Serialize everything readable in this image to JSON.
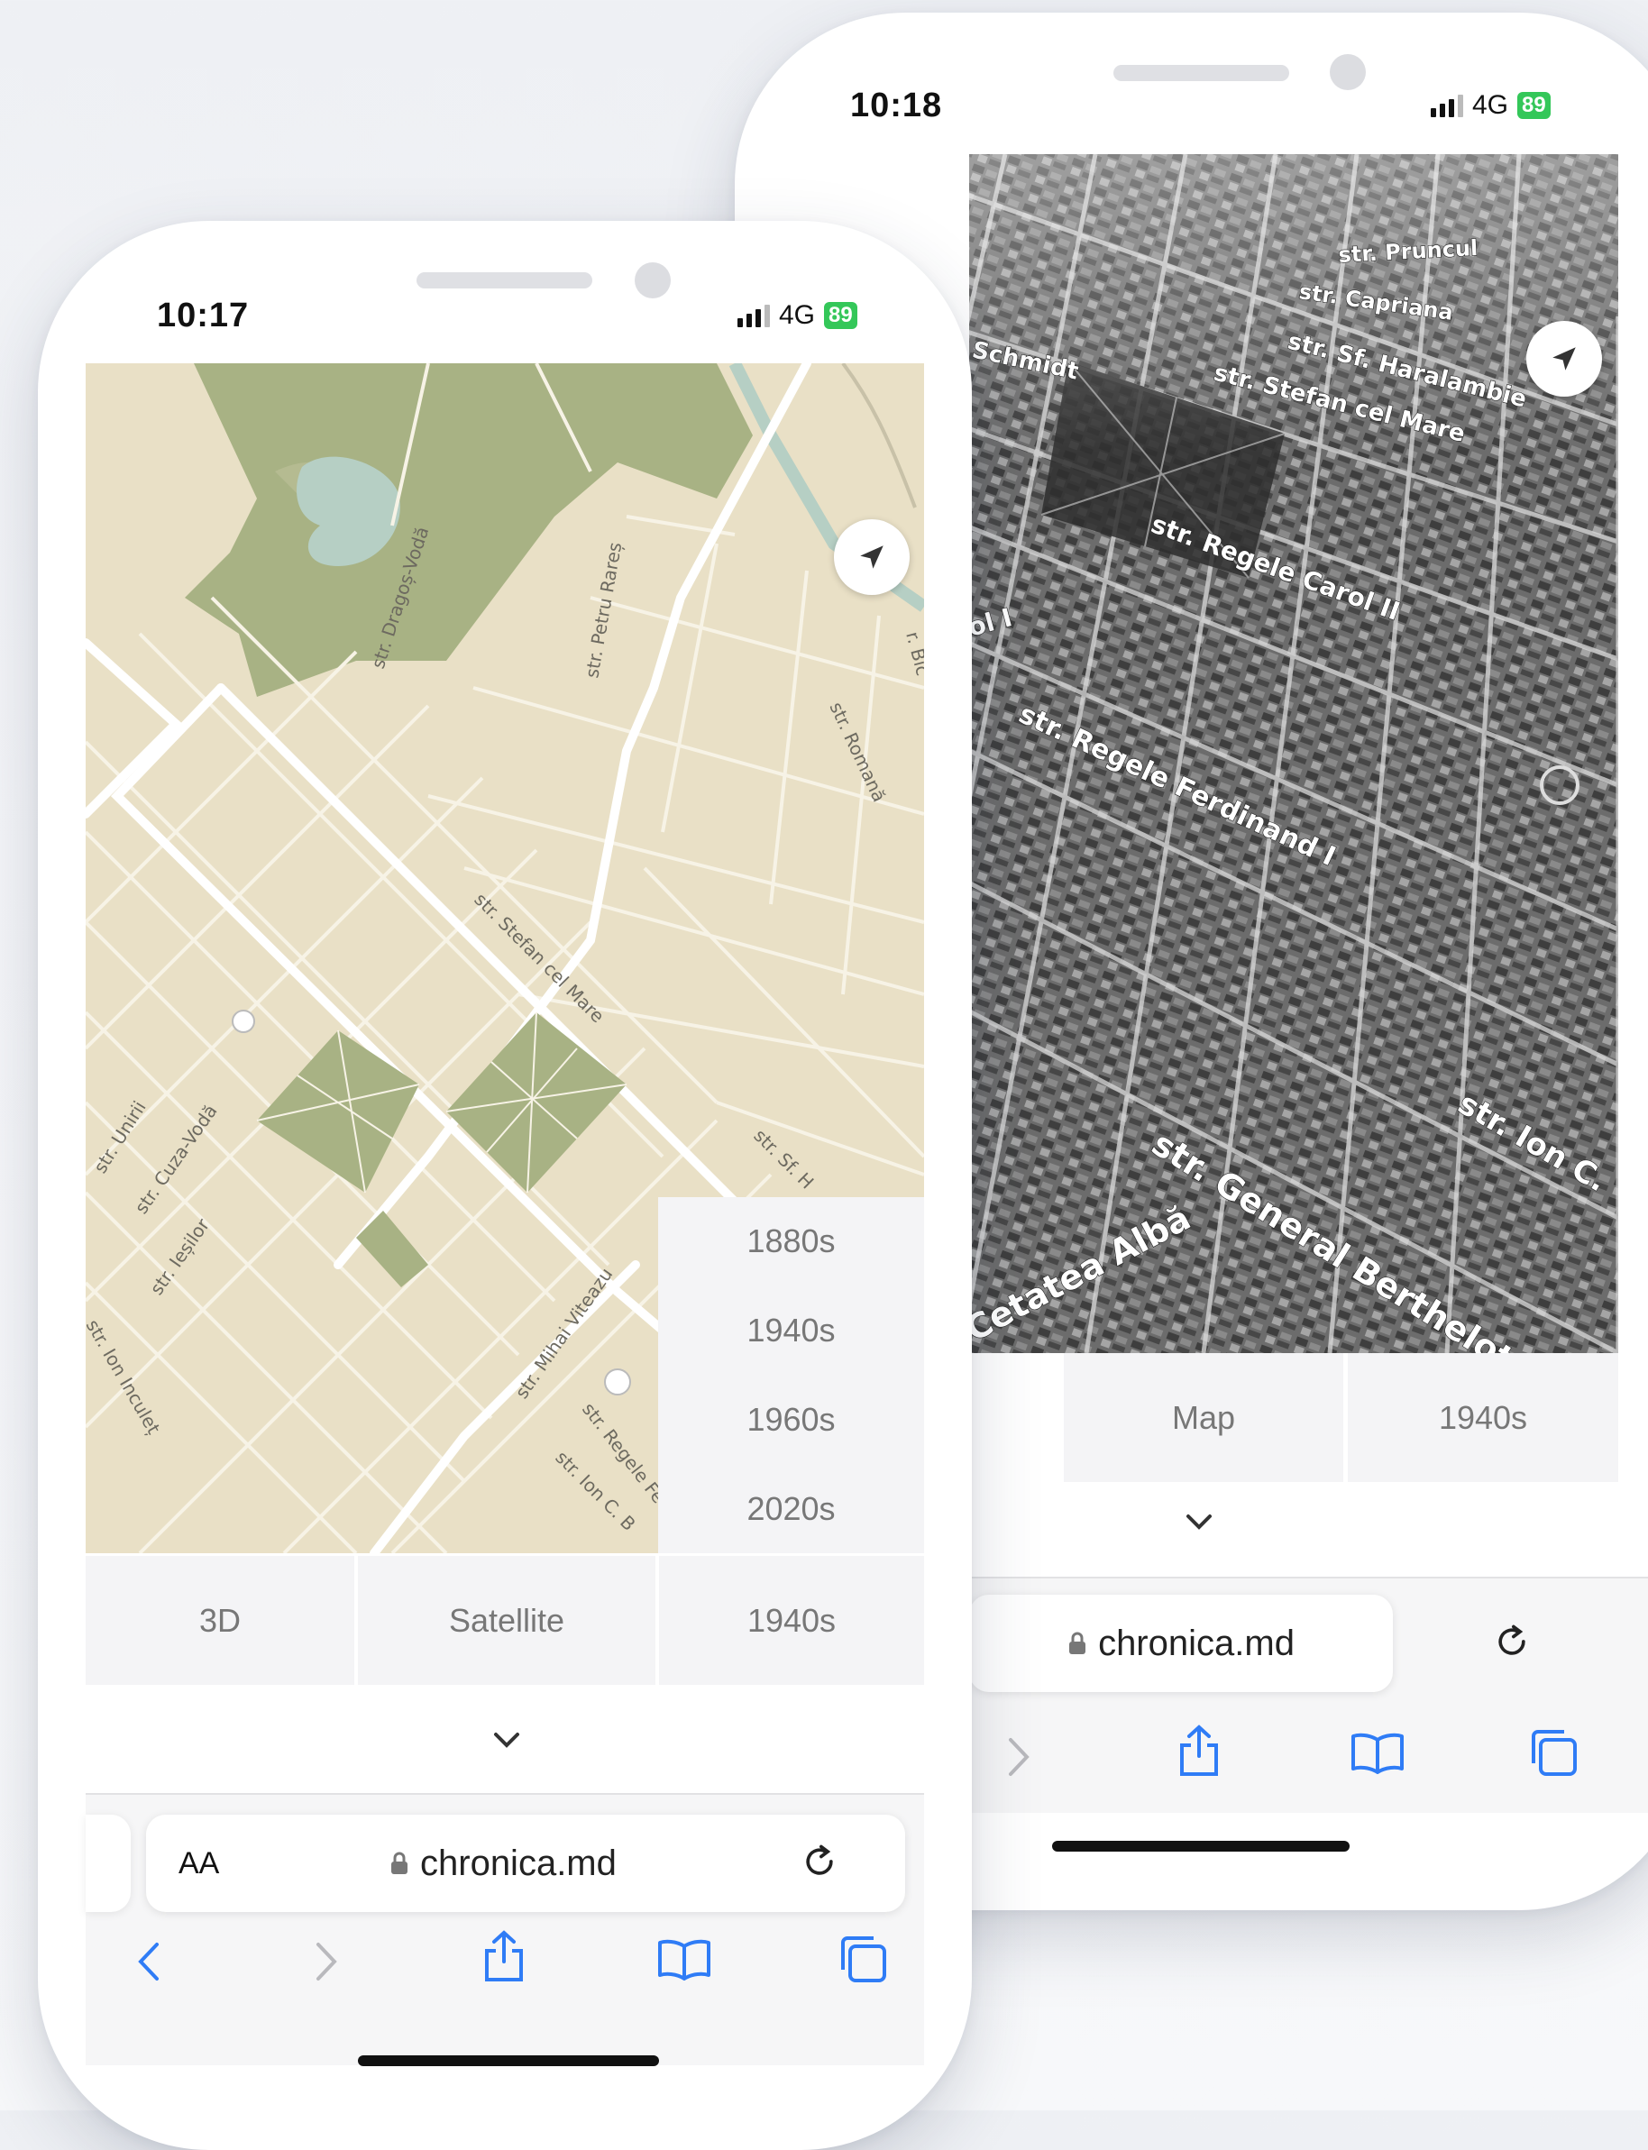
{
  "back_phone": {
    "time": "10:18",
    "network": "4G",
    "battery": "89",
    "map_labels": {
      "pruncul": "str. Pruncul",
      "capriana": "str. Capriana",
      "schmidt": "Schmidt",
      "haralambie": "str. Sf. Haralambie",
      "stefan": "str. Stefan cel Mare",
      "carol": "str. Regele Carol II",
      "carol_i": "ol I",
      "ferdinand": "str. Regele Ferdinand I",
      "ion_c": "str. Ion C.",
      "berthelot": "str. General Berthelot",
      "cetatea": "Cetatea Albă"
    },
    "controls": {
      "view": "Map",
      "period": "1940s"
    },
    "url": "chronica.md"
  },
  "front_phone": {
    "time": "10:17",
    "network": "4G",
    "battery": "89",
    "map_labels": {
      "dragos": "str. Dragoș-Vodă",
      "petru": "str. Petru Rareș",
      "bic": "r. Bîc",
      "romana": "str. Romană",
      "stefan": "str. Stefan cel Mare",
      "unirii": "str. Unirii",
      "cuza": "str. Cuza-Vodă",
      "iesilor": "str. Ieșilor",
      "inculet": "str. Ion Inculeț",
      "mihai": "str. Mihai Viteazu",
      "regele": "str. Regele Fe",
      "ionc": "str. Ion C. B",
      "sf": "str. Sf. H"
    },
    "period_options": [
      "1880s",
      "1940s",
      "1960s",
      "2020s"
    ],
    "controls": {
      "mode": "3D",
      "view": "Satellite",
      "period": "1940s"
    },
    "aa_label": "AA",
    "url": "chronica.md"
  },
  "colors": {
    "map_land": "#e9e0c6",
    "map_green": "#a8b284",
    "map_water": "#b6cfc4",
    "battery": "#34c759",
    "ios_blue": "#2f7cf6"
  }
}
